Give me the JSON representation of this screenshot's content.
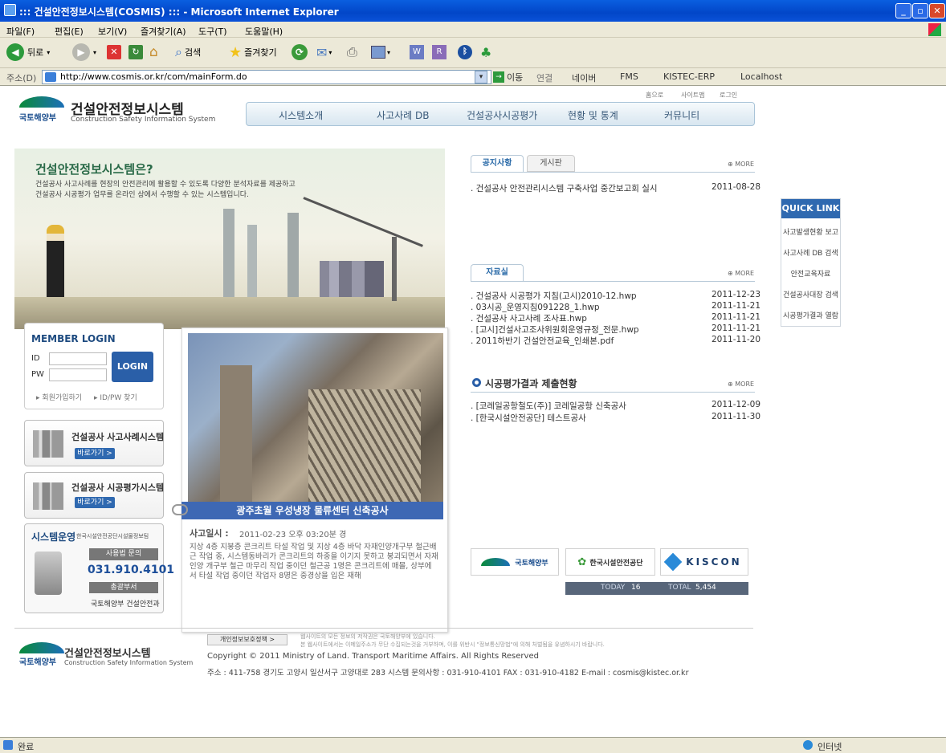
{
  "window": {
    "title": "::: 건설안전정보시스템(COSMIS) ::: - Microsoft Internet Explorer",
    "min": "_",
    "max": "▫",
    "close": "✕"
  },
  "menubar": [
    "파일(F)",
    "편집(E)",
    "보기(V)",
    "즐겨찾기(A)",
    "도구(T)",
    "도움말(H)"
  ],
  "toolbar": {
    "back": "뒤로",
    "search": "검색",
    "favorites": "즐겨찾기"
  },
  "address": {
    "label": "주소(D)",
    "url": "http://www.cosmis.or.kr/com/mainForm.do",
    "go": "이동",
    "links_label": "연결",
    "links": [
      "네이버",
      "FMS",
      "KISTEC-ERP",
      "Localhost"
    ]
  },
  "site": {
    "org": "국토해양부",
    "title": "건설안전정보시스템",
    "subtitle": "Construction Safety Information System",
    "util_links": [
      "홈으로",
      "사이트맵",
      "로그인"
    ],
    "nav": [
      "시스템소개",
      "사고사례 DB",
      "건설공사시공평가",
      "현황 및 통계",
      "커뮤니티"
    ]
  },
  "hero": {
    "heading": "건설안전정보시스템은?",
    "desc1": "건설공사 사고사례를 현장의 안전관리에 활용할 수 있도록 다양한 분석자료를 제공하고",
    "desc2": "건설공사 시공평가 업무를 온라인 상에서 수행할 수 있는 시스템입니다."
  },
  "login": {
    "title": "MEMBER LOGIN",
    "id_label": "ID",
    "pw_label": "PW",
    "button": "LOGIN",
    "join": "▸ 회원가입하기",
    "find": "▸ ID/PW 찾기"
  },
  "systems": [
    {
      "title": "건설공사 사고사례시스템",
      "go": "바로가기 >"
    },
    {
      "title": "건설공사 시공평가시스템",
      "go": "바로가기 >"
    }
  ],
  "operation": {
    "title": "시스템운영",
    "org": "한국시설안전공단시설물정보팀",
    "inquiry": "사용법 문의",
    "phone": "031.910.4101",
    "dept_label": "총괄부서",
    "dept": "국토해양부 건설안전과"
  },
  "accident": {
    "caption": "광주초월 우성냉장 물류센터 신축공사",
    "date_label": "사고일시 :",
    "date": "2011-02-23 오후 03:20분 경",
    "body": "지상 4층 지붕층 콘크리트 타설 작업 및 지상 4층 바닥 자재인양개구부 철근배근 작업 중, 시스템동바리가 콘크리트의 하중을 이기지 못하고 붕괴되면서 자재인양 개구부 철근 마무리 작업 중이던 철근공 1명은 콘크리트에 매몰, 상부에서 타설 작업 중이던 작업자 8명은 중경상을 입은 재해"
  },
  "notice": {
    "tab_active": "공지사항",
    "tab_other": "게시판",
    "more": "⊕ MORE",
    "items": [
      {
        "title": ". 건설공사 안전관리시스템 구축사업 중간보고회 실시",
        "date": "2011-08-28"
      }
    ]
  },
  "resources": {
    "tab": "자료실",
    "more": "⊕ MORE",
    "items": [
      {
        "title": ". 건설공사 시공평가 지침(고시)2010-12.hwp",
        "date": "2011-12-23"
      },
      {
        "title": ". 03시공_운영지침091228_1.hwp",
        "date": "2011-11-21"
      },
      {
        "title": ". 건설공사 사고사례 조사표.hwp",
        "date": "2011-11-21"
      },
      {
        "title": ". [고시]건설사고조사위원회운영규정_전문.hwp",
        "date": "2011-11-21"
      },
      {
        "title": ". 2011하반기 건설안전교육_인쇄본.pdf",
        "date": "2011-11-20"
      }
    ]
  },
  "evaluation": {
    "title": "시공평가결과 제출현황",
    "more": "⊕ MORE",
    "items": [
      {
        "title": ". [코레일공항철도(주)] 코레일공항 신축공사",
        "date": "2011-12-09"
      },
      {
        "title": ". [한국시설안전공단] 테스트공사",
        "date": "2011-11-30"
      }
    ]
  },
  "quicklink": {
    "title": "QUICK LINK",
    "items": [
      "사고발생현황 보고",
      "사고사례 DB 검색",
      "안전교육자료",
      "건설공사대장 검색",
      "시공평가결과 열람"
    ]
  },
  "partners": [
    "국토해양부",
    "한국시설안전공단",
    "KISCON"
  ],
  "counter": {
    "today_label": "TODAY",
    "today": "16",
    "total_label": "TOTAL",
    "total": "5,454"
  },
  "footer": {
    "privacy": "개인정보보호정책 >",
    "notice1": "웹사이트의 모든 정보의 저작권은 국토해양부에 있습니다.",
    "notice2": "본 웹사이트에서는 이메일주소가 무단 수집되는것을 거부하며, 이를 위반시 \"정보통신망법\"에 의해 처벌됨을 유념하시기 바랍니다.",
    "copyright": "Copyright © 2011 Ministry of Land. Transport Maritime Affairs. All Rights Reserved",
    "address": "주소 : 411-758 경기도 고양시 일산서구 고양대로 283 시스템 문의사항 : 031-910-4101  FAX : 031-910-4182  E-mail : cosmis@kistec.or.kr"
  },
  "status": {
    "left": "완료",
    "right": "인터넷"
  }
}
